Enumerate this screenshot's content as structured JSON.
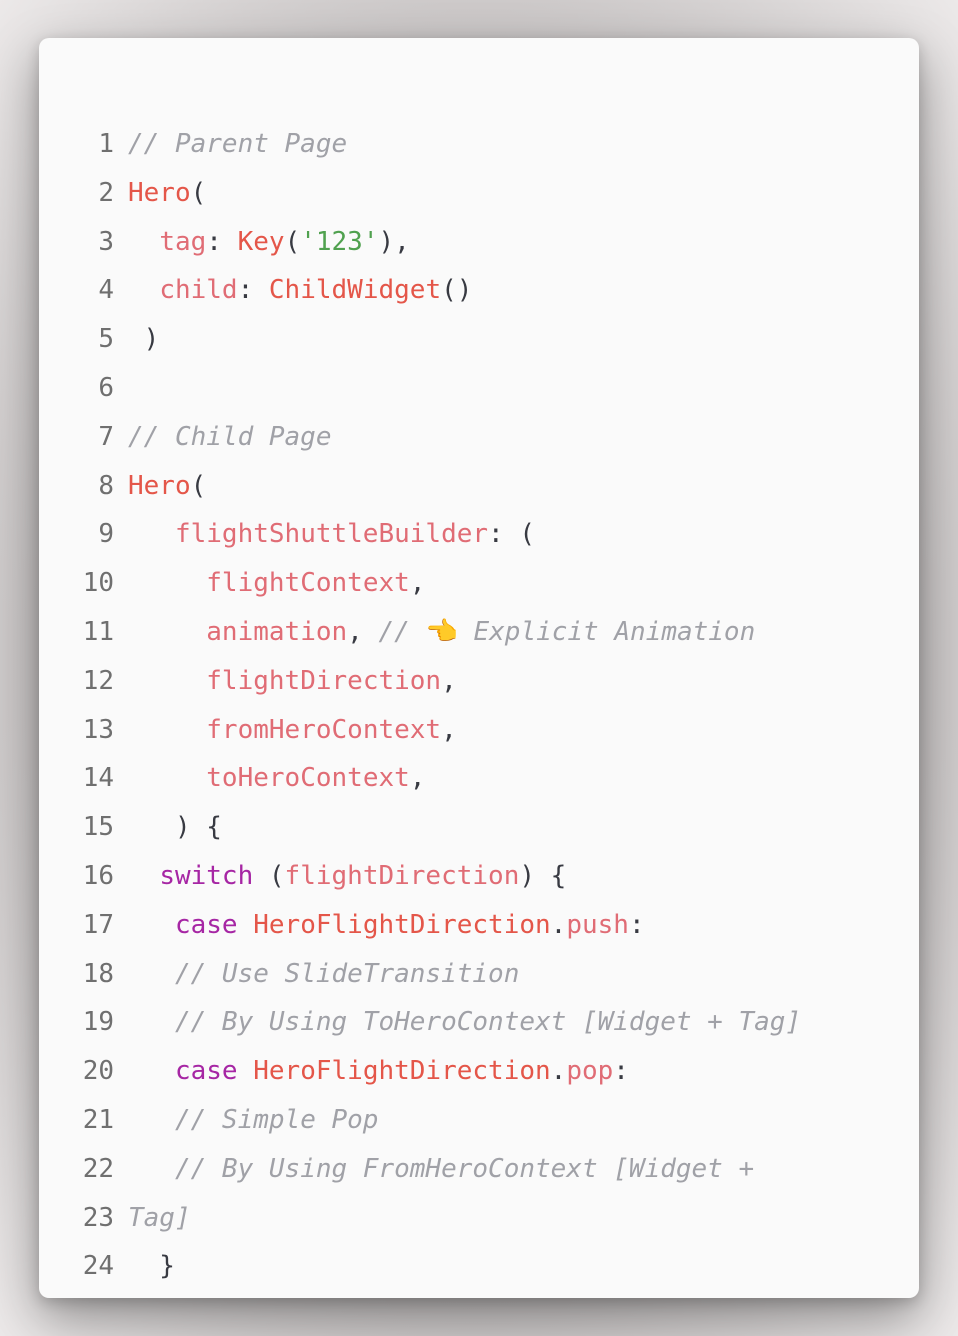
{
  "code_lines": [
    {
      "n": "1",
      "tokens": [
        {
          "t": "// Parent Page",
          "c": "cm"
        }
      ]
    },
    {
      "n": "2",
      "tokens": [
        {
          "t": "Hero",
          "c": "ty"
        },
        {
          "t": "(",
          "c": "pu"
        }
      ]
    },
    {
      "n": "3",
      "tokens": [
        {
          "t": "  ",
          "c": "pu"
        },
        {
          "t": "tag",
          "c": "pr"
        },
        {
          "t": ": ",
          "c": "pu"
        },
        {
          "t": "Key",
          "c": "ty"
        },
        {
          "t": "(",
          "c": "pu"
        },
        {
          "t": "'123'",
          "c": "st"
        },
        {
          "t": "),",
          "c": "pu"
        }
      ]
    },
    {
      "n": "4",
      "tokens": [
        {
          "t": "  ",
          "c": "pu"
        },
        {
          "t": "child",
          "c": "pr"
        },
        {
          "t": ": ",
          "c": "pu"
        },
        {
          "t": "ChildWidget",
          "c": "ty"
        },
        {
          "t": "()",
          "c": "pu"
        }
      ]
    },
    {
      "n": "5",
      "tokens": [
        {
          "t": " )",
          "c": "pu"
        }
      ]
    },
    {
      "n": "6",
      "tokens": []
    },
    {
      "n": "7",
      "tokens": [
        {
          "t": "// Child Page",
          "c": "cm"
        }
      ]
    },
    {
      "n": "8",
      "tokens": [
        {
          "t": "Hero",
          "c": "ty"
        },
        {
          "t": "(",
          "c": "pu"
        }
      ]
    },
    {
      "n": "9",
      "tokens": [
        {
          "t": "   ",
          "c": "pu"
        },
        {
          "t": "flightShuttleBuilder",
          "c": "pr"
        },
        {
          "t": ": (",
          "c": "pu"
        }
      ]
    },
    {
      "n": "10",
      "tokens": [
        {
          "t": "     ",
          "c": "pu"
        },
        {
          "t": "flightContext",
          "c": "pr"
        },
        {
          "t": ",",
          "c": "pu"
        }
      ]
    },
    {
      "n": "11",
      "tokens": [
        {
          "t": "     ",
          "c": "pu"
        },
        {
          "t": "animation",
          "c": "pr"
        },
        {
          "t": ", ",
          "c": "pu"
        },
        {
          "t": "// ",
          "c": "cm"
        },
        {
          "t": "👈",
          "c": "emoji"
        },
        {
          "t": " Explicit Animation",
          "c": "cm"
        }
      ]
    },
    {
      "n": "12",
      "tokens": [
        {
          "t": "     ",
          "c": "pu"
        },
        {
          "t": "flightDirection",
          "c": "pr"
        },
        {
          "t": ",",
          "c": "pu"
        }
      ]
    },
    {
      "n": "13",
      "tokens": [
        {
          "t": "     ",
          "c": "pu"
        },
        {
          "t": "fromHeroContext",
          "c": "pr"
        },
        {
          "t": ",",
          "c": "pu"
        }
      ]
    },
    {
      "n": "14",
      "tokens": [
        {
          "t": "     ",
          "c": "pu"
        },
        {
          "t": "toHeroContext",
          "c": "pr"
        },
        {
          "t": ",",
          "c": "pu"
        }
      ]
    },
    {
      "n": "15",
      "tokens": [
        {
          "t": "   ) {",
          "c": "pu"
        }
      ]
    },
    {
      "n": "16",
      "tokens": [
        {
          "t": "  ",
          "c": "pu"
        },
        {
          "t": "switch",
          "c": "kw"
        },
        {
          "t": " (",
          "c": "pu"
        },
        {
          "t": "flightDirection",
          "c": "pr"
        },
        {
          "t": ") {",
          "c": "pu"
        }
      ]
    },
    {
      "n": "17",
      "tokens": [
        {
          "t": "   ",
          "c": "pu"
        },
        {
          "t": "case",
          "c": "kw"
        },
        {
          "t": " ",
          "c": "pu"
        },
        {
          "t": "HeroFlightDirection",
          "c": "ty"
        },
        {
          "t": ".",
          "c": "pu"
        },
        {
          "t": "push",
          "c": "pr"
        },
        {
          "t": ":",
          "c": "pu"
        }
      ]
    },
    {
      "n": "18",
      "tokens": [
        {
          "t": "   ",
          "c": "pu"
        },
        {
          "t": "// Use SlideTransition",
          "c": "cm"
        }
      ]
    },
    {
      "n": "19",
      "tokens": [
        {
          "t": "   ",
          "c": "pu"
        },
        {
          "t": "// By Using ToHeroContext [Widget + Tag]",
          "c": "cm"
        }
      ]
    },
    {
      "n": "20",
      "tokens": [
        {
          "t": "   ",
          "c": "pu"
        },
        {
          "t": "case",
          "c": "kw"
        },
        {
          "t": " ",
          "c": "pu"
        },
        {
          "t": "HeroFlightDirection",
          "c": "ty"
        },
        {
          "t": ".",
          "c": "pu"
        },
        {
          "t": "pop",
          "c": "pr"
        },
        {
          "t": ":",
          "c": "pu"
        }
      ]
    },
    {
      "n": "21",
      "tokens": [
        {
          "t": "   ",
          "c": "pu"
        },
        {
          "t": "// Simple Pop",
          "c": "cm"
        }
      ]
    },
    {
      "n": "22",
      "tokens": [
        {
          "t": "   ",
          "c": "pu"
        },
        {
          "t": "// By Using FromHeroContext [Widget +",
          "c": "cm"
        }
      ]
    },
    {
      "n": "23",
      "tokens": [
        {
          "t": "Tag]",
          "c": "cm"
        }
      ]
    },
    {
      "n": "24",
      "tokens": [
        {
          "t": "  }",
          "c": "pu"
        }
      ]
    }
  ],
  "colors": {
    "comment": "#a0a1a7",
    "type": "#e45649",
    "property": "#e06c75",
    "keyword": "#a626a4",
    "string": "#50a14f",
    "punctuation": "#383a42",
    "line_number": "#6f6f6f",
    "card_background": "#fafafa"
  }
}
